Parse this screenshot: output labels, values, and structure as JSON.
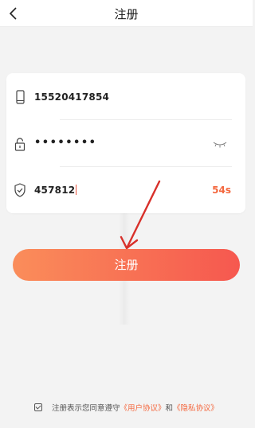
{
  "header": {
    "title": "注册"
  },
  "form": {
    "phone": {
      "value": "15520417854",
      "icon": "phone-icon"
    },
    "password": {
      "value": "••••••••",
      "icon": "lock-icon",
      "toggle_icon": "eye-closed-icon"
    },
    "code": {
      "value": "457812",
      "icon": "shield-check-icon",
      "countdown": "54s"
    }
  },
  "submit": {
    "label": "注册"
  },
  "agreement": {
    "prefix": "注册表示您同意遵守",
    "user_agreement": "《用户协议》",
    "and": "和",
    "privacy_policy": "《隐私协议》"
  },
  "colors": {
    "accent": "#f4683f",
    "button_start": "#fa8d5a",
    "button_end": "#f6584f",
    "arrow": "#d8302a"
  }
}
